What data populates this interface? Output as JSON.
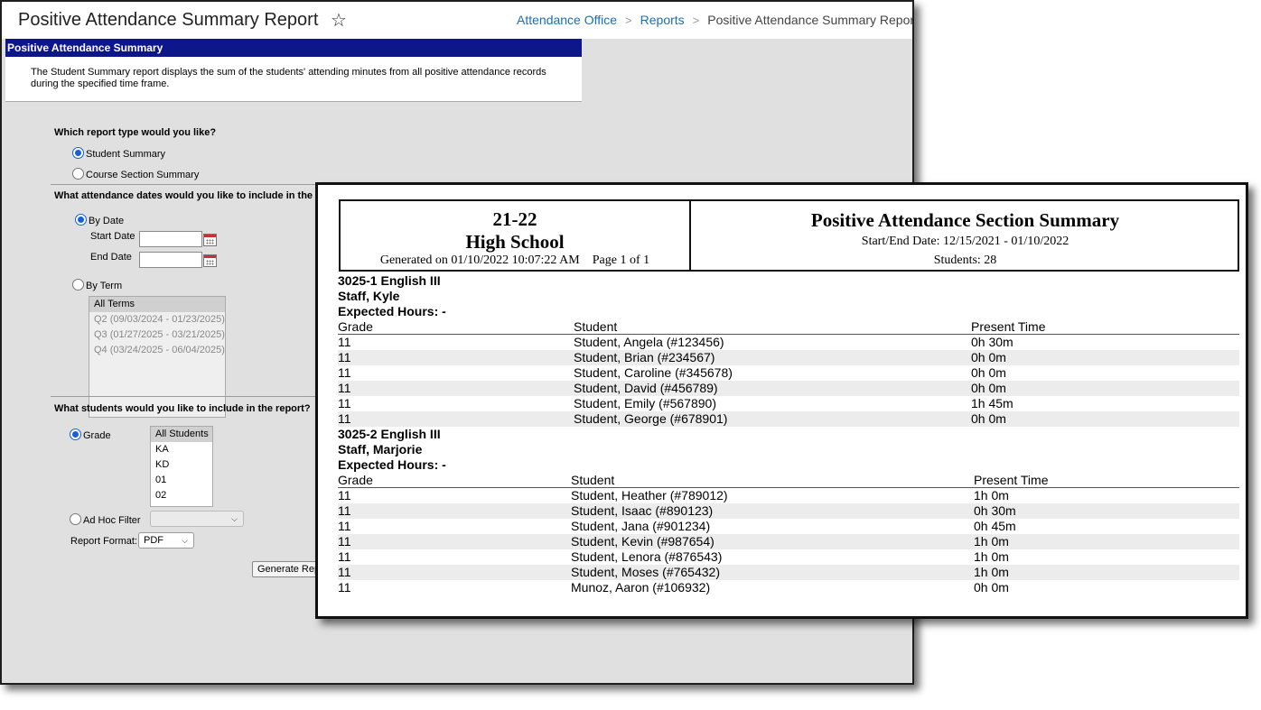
{
  "app": {
    "title": "Positive Attendance Summary Report",
    "breadcrumbs": [
      "Attendance Office",
      "Reports",
      "Positive Attendance Summary Report"
    ]
  },
  "form": {
    "header": "Positive Attendance Summary",
    "description_line1": "The Student Summary report displays the sum of the students' attending minutes from all positive attendance records",
    "description_line2": "during the specified time frame.",
    "report_type_q": "Which report type would you like?",
    "report_type_options": [
      "Student Summary",
      "Course Section Summary"
    ],
    "report_type_selected": "Student Summary",
    "dates_q": "What attendance dates would you like to include in the re",
    "by_date": "By Date",
    "start_date_label": "Start Date",
    "end_date_label": "End Date",
    "by_term": "By Term",
    "terms": [
      "All Terms",
      "Q2 (09/03/2024 - 01/23/2025)",
      "Q3 (01/27/2025 - 03/21/2025)",
      "Q4 (03/24/2025 - 06/04/2025)"
    ],
    "students_q": "What students would you like to include in the report?",
    "grade_label": "Grade",
    "grades": [
      "All Students",
      "KA",
      "KD",
      "01",
      "02"
    ],
    "adhoc_label": "Ad Hoc Filter",
    "format_label": "Report Format:",
    "format_value": "PDF",
    "generate_label": "Generate Report"
  },
  "report": {
    "year": "21-22",
    "school": "High School",
    "generated": "Generated on 01/10/2022 10:07:22 AM",
    "page": "Page 1 of  1",
    "title": "Positive Attendance Section Summary",
    "dates": "Start/End Date: 12/15/2021 - 01/10/2022",
    "students": "Students: 28",
    "columns": [
      "Grade",
      "Student",
      "Present Time"
    ],
    "sections": [
      {
        "course": "3025-1 English III",
        "teacher": "Staff, Kyle",
        "expected": "Expected Hours: -",
        "rows": [
          [
            "11",
            "Student, Angela (#123456)",
            "0h 30m"
          ],
          [
            "11",
            "Student, Brian (#234567)",
            "0h 0m"
          ],
          [
            "11",
            "Student, Caroline (#345678)",
            "0h 0m"
          ],
          [
            "11",
            "Student, David (#456789)",
            "0h 0m"
          ],
          [
            "11",
            "Student, Emily (#567890)",
            "1h 45m"
          ],
          [
            "11",
            "Student, George (#678901)",
            "0h 0m"
          ]
        ]
      },
      {
        "course": "3025-2 English III",
        "teacher": "Staff, Marjorie",
        "expected": "Expected Hours: -",
        "rows": [
          [
            "11",
            "Student, Heather (#789012)",
            "1h 0m"
          ],
          [
            "11",
            "Student, Isaac (#890123)",
            "0h 30m"
          ],
          [
            "11",
            "Student, Jana (#901234)",
            "0h 45m"
          ],
          [
            "11",
            "Student, Kevin (#987654)",
            "1h 0m"
          ],
          [
            "11",
            "Student, Lenora (#876543)",
            "1h 0m"
          ],
          [
            "11",
            "Student, Moses (#765432)",
            "1h 0m"
          ],
          [
            "11",
            "Munoz, Aaron (#106932)",
            "0h 0m"
          ]
        ]
      }
    ]
  }
}
